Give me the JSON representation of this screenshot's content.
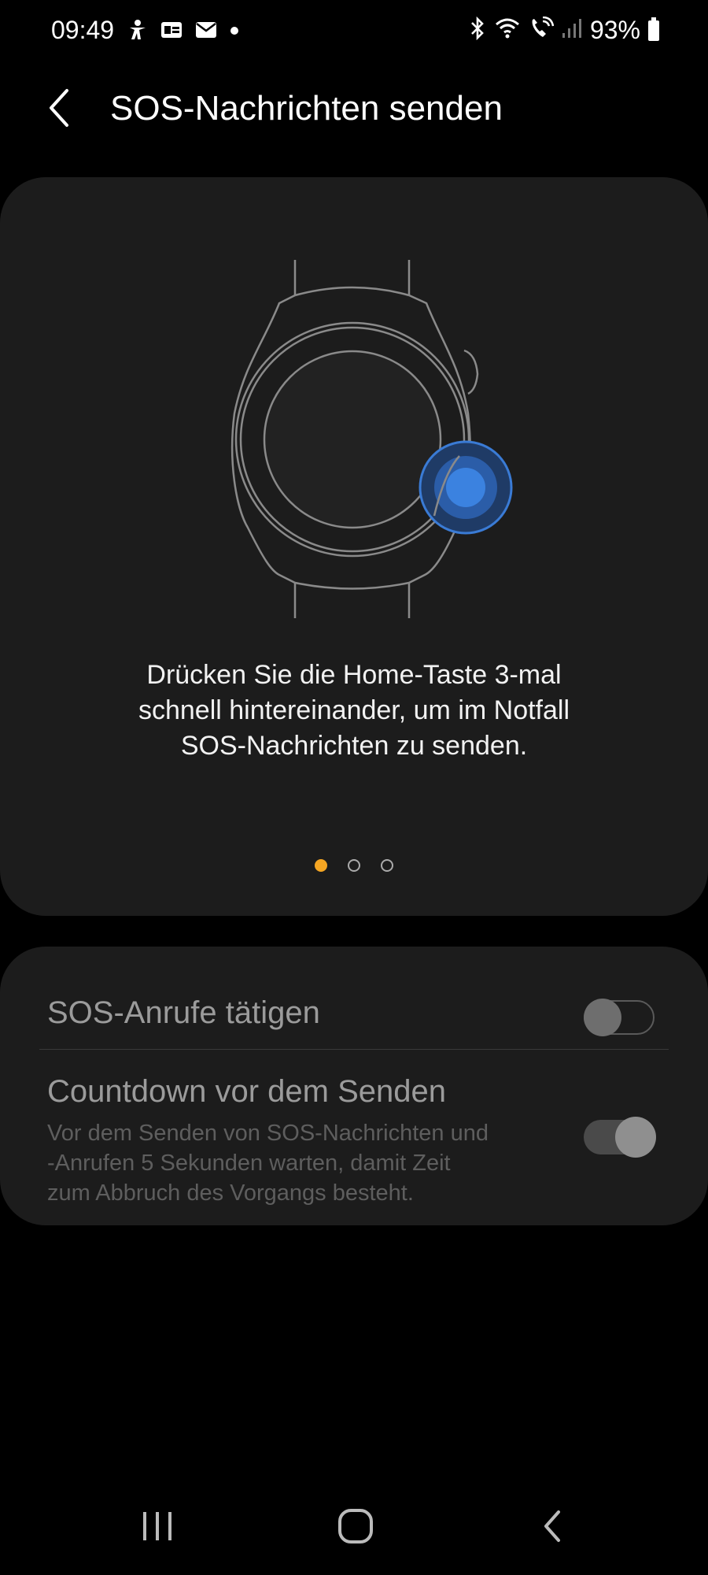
{
  "status_bar": {
    "time": "09:49",
    "battery": "93%",
    "icons_left": [
      "accessibility-icon",
      "id-card-icon",
      "mail-icon",
      "dot-icon"
    ],
    "icons_right": [
      "bluetooth-icon",
      "wifi-icon",
      "wifi-call-icon",
      "signal-icon",
      "battery-icon"
    ]
  },
  "app_bar": {
    "title": "SOS-Nachrichten senden",
    "back_icon": "chevron-left-icon"
  },
  "illustration": {
    "image": "watch-home-button-icon",
    "description_lines": [
      "Drücken Sie die Home-Taste 3-mal",
      "schnell hintereinander, um im Notfall",
      "SOS-Nachrichten zu senden."
    ],
    "page_indicator": {
      "total": 3,
      "active": 1,
      "active_color": "#f5a623"
    }
  },
  "settings": {
    "sos_calls": {
      "label": "SOS-Anrufe tätigen",
      "enabled": false
    },
    "countdown": {
      "label": "Countdown vor dem Senden",
      "description_lines": [
        "Vor dem Senden von SOS-Nachrichten und",
        "-Anrufen 5 Sekunden warten, damit Zeit",
        "zum Abbruch des Vorgangs besteht."
      ],
      "enabled": true
    }
  },
  "nav_bar": {
    "recents_icon": "recents-icon",
    "home_icon": "home-icon",
    "back_icon": "back-icon"
  },
  "colors": {
    "background": "#000000",
    "card": "#1c1c1c",
    "accent_dot": "#f5a623",
    "highlight_blue": "#3a7bd5"
  }
}
